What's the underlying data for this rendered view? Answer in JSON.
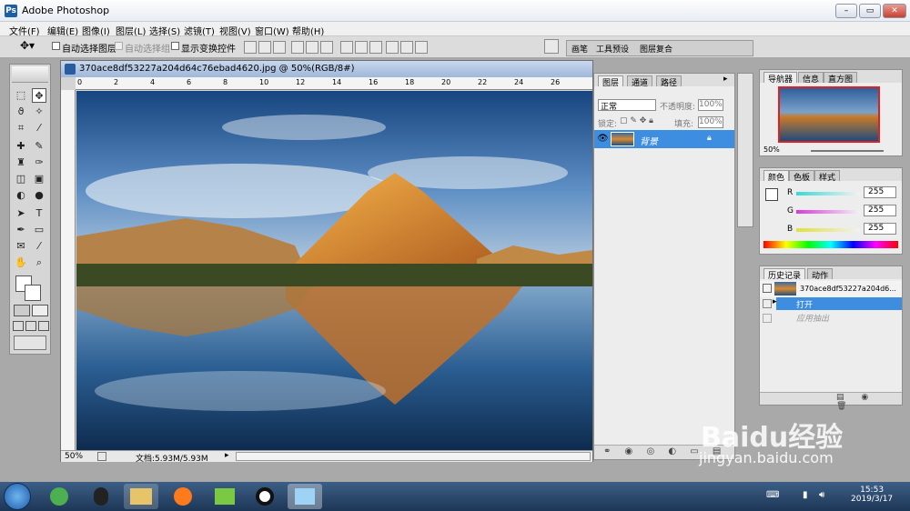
{
  "window": {
    "title": "Adobe Photoshop"
  },
  "menu": [
    "文件(F)",
    "编辑(E)",
    "图像(I)",
    "图层(L)",
    "选择(S)",
    "滤镜(T)",
    "视图(V)",
    "窗口(W)",
    "帮助(H)"
  ],
  "options": {
    "auto_select_layer": "自动选择图层",
    "auto_select_group": "自动选择组",
    "show_transform": "显示变换控件",
    "right_tabs": [
      "画笔",
      "工具预设",
      "图层复合"
    ]
  },
  "document": {
    "title": "370ace8df53227a204d64c76ebad4620.jpg @ 50%(RGB/8#)",
    "zoom": "50%",
    "doc_size": "文档:5.93M/5.93M",
    "ruler_marks": [
      "0",
      "2",
      "4",
      "6",
      "8",
      "10",
      "12",
      "14",
      "16",
      "18",
      "20",
      "22",
      "24",
      "26"
    ]
  },
  "layers_panel": {
    "tabs": [
      "图层",
      "通道",
      "路径"
    ],
    "blend_mode": "正常",
    "opacity_label": "不透明度:",
    "opacity": "100%",
    "lock_label": "锁定:",
    "fill_label": "填充:",
    "fill": "100%",
    "layer_name": "背景"
  },
  "navigator_panel": {
    "tabs": [
      "导航器",
      "信息",
      "直方图"
    ],
    "zoom": "50%"
  },
  "color_panel": {
    "tabs": [
      "颜色",
      "色板",
      "样式"
    ],
    "channels": [
      {
        "label": "R",
        "value": "255"
      },
      {
        "label": "G",
        "value": "255"
      },
      {
        "label": "B",
        "value": "255"
      }
    ]
  },
  "history_panel": {
    "tabs": [
      "历史记录",
      "动作"
    ],
    "snapshot": "370ace8df53227a204d6...",
    "items": [
      "打开",
      "应用抽出"
    ]
  },
  "taskbar": {
    "time": "15:53",
    "date": "2019/3/17"
  },
  "watermark": {
    "brand": "Baidu经验",
    "url": "jingyan.baidu.com"
  }
}
